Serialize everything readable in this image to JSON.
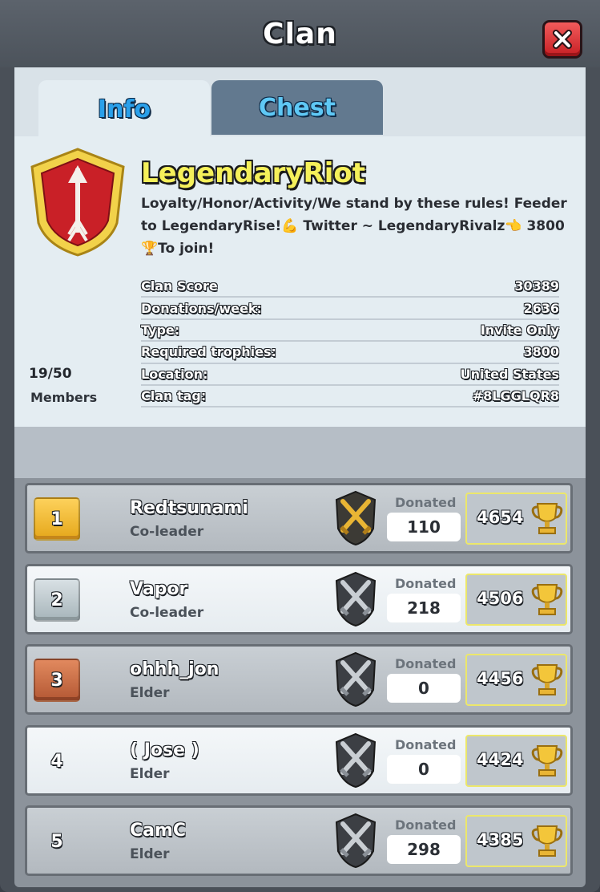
{
  "header": {
    "title": "Clan"
  },
  "tabs": [
    {
      "label": "Info"
    },
    {
      "label": "Chest"
    }
  ],
  "clan": {
    "name": "LegendaryRiot",
    "description": "Loyalty/Honor/Activity/We stand by these rules! Feeder to LegendaryRise!💪 Twitter ~ LegendaryRivalz👈 3800🏆To join!",
    "members_count": "19/50",
    "members_label": "Members"
  },
  "stats": [
    {
      "label": "Clan Score",
      "value": "30389"
    },
    {
      "label": "Donations/week:",
      "value": "2636"
    },
    {
      "label": "Type:",
      "value": "Invite Only"
    },
    {
      "label": "Required trophies:",
      "value": "3800"
    },
    {
      "label": "Location:",
      "value": "United States"
    },
    {
      "label": "Clan tag:",
      "value": "#8LGGLQR8"
    }
  ],
  "donated_label": "Donated",
  "members": [
    {
      "rank": "1",
      "name": "Redtsunami",
      "role": "Co-leader",
      "donated": "110",
      "trophies": "4654",
      "rank_color": "gold",
      "badge": "gold-crossed-swords-icon"
    },
    {
      "rank": "2",
      "name": "Vapor",
      "role": "Co-leader",
      "donated": "218",
      "trophies": "4506",
      "rank_color": "silver",
      "badge": "silver-crossed-swords-icon"
    },
    {
      "rank": "3",
      "name": "ohhh_jon",
      "role": "Elder",
      "donated": "0",
      "trophies": "4456",
      "rank_color": "bronze",
      "badge": "silver-crossed-swords-icon"
    },
    {
      "rank": "4",
      "name": "( Jose )",
      "role": "Elder",
      "donated": "0",
      "trophies": "4424",
      "rank_color": "none",
      "badge": "silver-crossed-swords-icon"
    },
    {
      "rank": "5",
      "name": "CamC",
      "role": "Elder",
      "donated": "298",
      "trophies": "4385",
      "rank_color": "none",
      "badge": "silver-crossed-swords-icon"
    }
  ]
}
